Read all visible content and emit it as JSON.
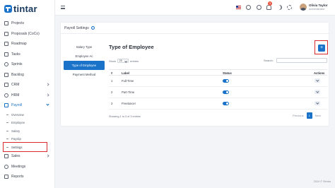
{
  "brand": {
    "name": "tintar",
    "letter": "S"
  },
  "sidebar": {
    "items": [
      {
        "label": "Projects"
      },
      {
        "label": "Proposals (CoCo)"
      },
      {
        "label": "Roadmap"
      },
      {
        "label": "Tasks"
      },
      {
        "label": "Sprints"
      },
      {
        "label": "Backlog"
      },
      {
        "label": "CRM"
      },
      {
        "label": "HRM"
      },
      {
        "label": "Payroll"
      }
    ],
    "payroll_sub": [
      {
        "label": "Overview"
      },
      {
        "label": "Employee"
      },
      {
        "label": "Salary"
      },
      {
        "label": "Payslip"
      },
      {
        "label": "Settings"
      }
    ],
    "after": [
      {
        "label": "Sales"
      },
      {
        "label": "Meetings"
      },
      {
        "label": "Reports"
      }
    ]
  },
  "topbar": {
    "notification_count": "3",
    "user_name": "Olivia Taylor",
    "user_role": "Administrator"
  },
  "page": {
    "title": "Payroll Settings",
    "tabs": [
      {
        "label": "Salary Type"
      },
      {
        "label": "Employee Ac"
      },
      {
        "label": "Type of Employee"
      },
      {
        "label": "Payment Method"
      }
    ],
    "panel_title": "Type of Employee",
    "add_label": "+",
    "show_label": "Show",
    "entries_value": "25",
    "entries_label": "entries",
    "search_label": "Search:",
    "columns": {
      "num": "#",
      "label": "Label",
      "status": "Status",
      "actions": "Actions"
    },
    "rows": [
      {
        "num": "1",
        "label": "Full-Time",
        "status": "on"
      },
      {
        "num": "2",
        "label": "Part-Time",
        "status": "on"
      },
      {
        "num": "3",
        "label": "Freelancer",
        "status": "on"
      }
    ],
    "showing_text": "Showing 1 to 3 of 3 entries",
    "pager": {
      "prev": "Previous",
      "current": "1",
      "next": "Next"
    }
  },
  "footer": {
    "text": "2024 © Stintar"
  },
  "colors": {
    "accent": "#1a73c9",
    "highlight": "#d92b2b"
  }
}
